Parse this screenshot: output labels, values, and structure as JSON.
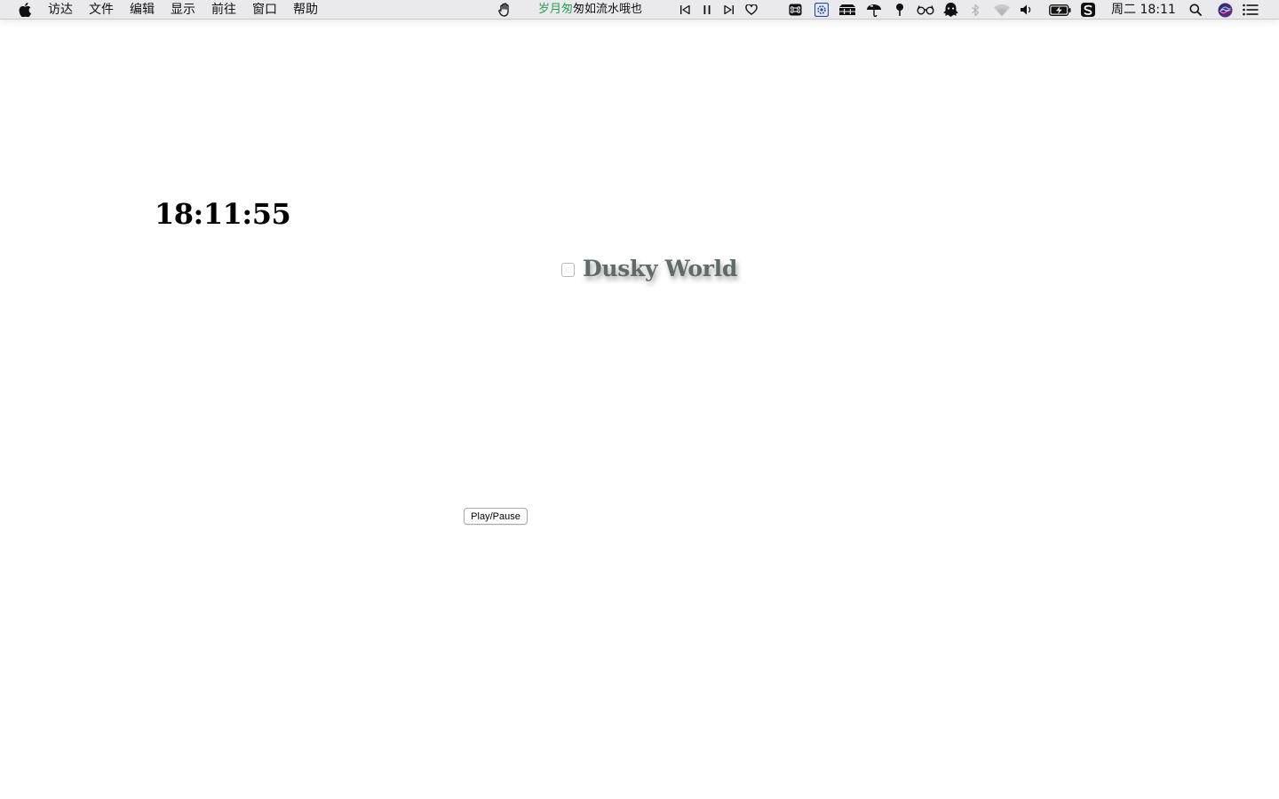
{
  "menubar": {
    "app_icon": "apple-icon",
    "items": [
      "访达",
      "文件",
      "编辑",
      "显示",
      "前往",
      "窗口",
      "帮助"
    ],
    "lyrics_played": "岁月匆",
    "lyrics_rest": "匆如流水哦也",
    "lyrics_played_color": "#2aa04a",
    "datetime": "周二 18:11",
    "status_icons": [
      "hand-icon",
      "previous-track-icon",
      "pause-icon",
      "next-track-icon",
      "heart-icon",
      "command-icon",
      "gear-badge-icon",
      "stack-icon",
      "umbrella-icon",
      "pin-icon",
      "glasses-icon",
      "ghost-icon",
      "bluetooth-icon",
      "wifi-icon",
      "volume-icon",
      "battery-charging-icon",
      "s-app-icon",
      "search-icon",
      "siri-icon",
      "list-icon"
    ]
  },
  "page": {
    "time": "18:11:55",
    "title": "Dusky World",
    "play_button": "Play/Pause"
  }
}
